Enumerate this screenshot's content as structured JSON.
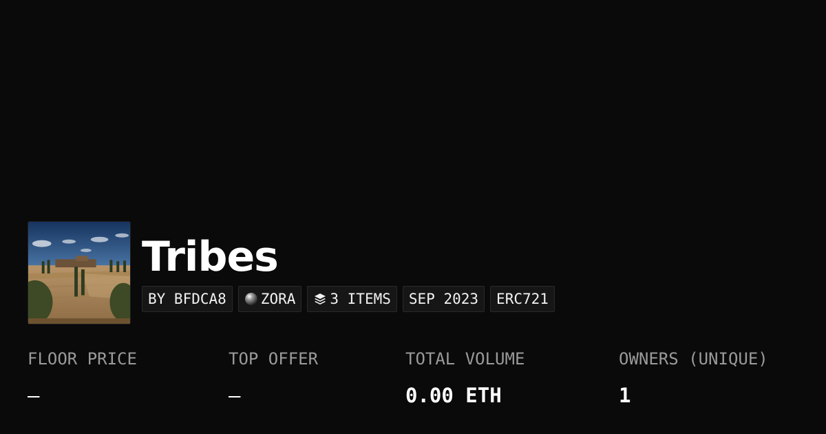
{
  "collection": {
    "title": "Tribes",
    "thumbnail_icon": "landscape-image",
    "tags": {
      "creator": "BY BFDCA8",
      "chain": "ZORA",
      "chain_icon": "zora-orb-icon",
      "items": "3 ITEMS",
      "items_icon": "layers-icon",
      "date": "SEP 2023",
      "standard": "ERC721"
    }
  },
  "stats": {
    "floor_price": {
      "label": "FLOOR PRICE",
      "value": "—"
    },
    "top_offer": {
      "label": "TOP OFFER",
      "value": "—"
    },
    "total_volume": {
      "label": "TOTAL VOLUME",
      "value": "0.00 ETH"
    },
    "owners": {
      "label": "OWNERS (UNIQUE)",
      "value": "1"
    }
  },
  "colors": {
    "background": "#0a0a0a",
    "text": "#ffffff",
    "label": "#9a9a9a",
    "tag_bg": "#161616",
    "tag_border": "#2a2a2a"
  }
}
